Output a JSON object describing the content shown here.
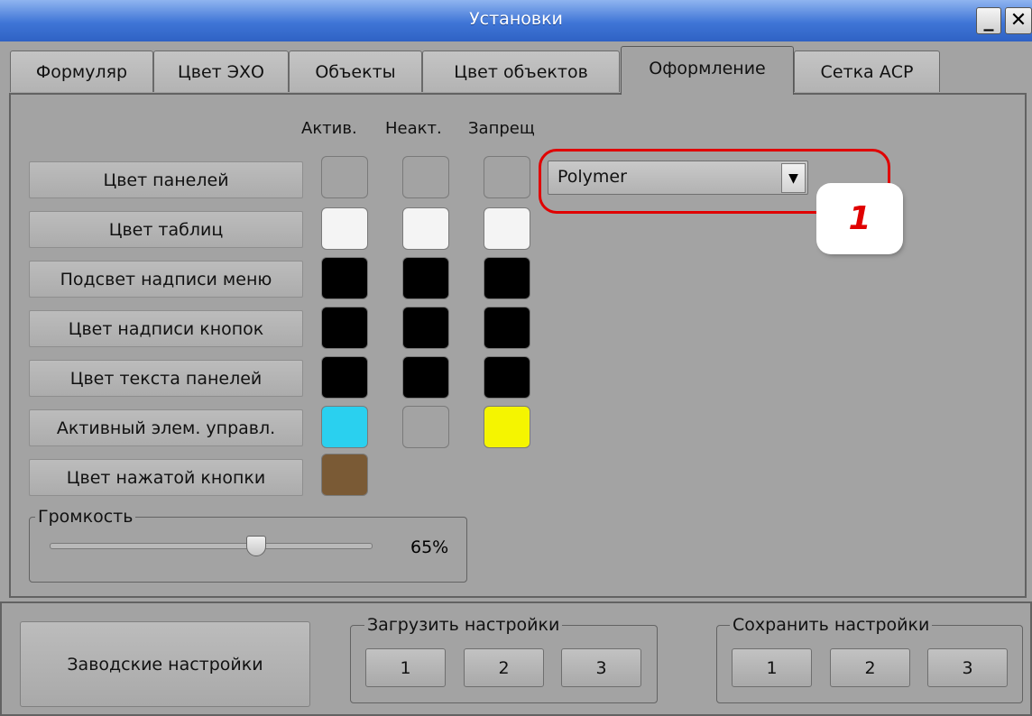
{
  "window": {
    "title": "Установки"
  },
  "tabs": [
    "Формуляр",
    "Цвет ЭХО",
    "Объекты",
    "Цвет объектов",
    "Оформление",
    "Сетка АСР"
  ],
  "active_tab": "Оформление",
  "columns": [
    "Актив.",
    "Неакт.",
    "Запрещ"
  ],
  "rows": [
    {
      "label": "Цвет панелей",
      "colors": [
        "#a3a3a3",
        "#a3a3a3",
        "#a3a3a3"
      ]
    },
    {
      "label": "Цвет таблиц",
      "colors": [
        "#f4f4f4",
        "#f4f4f4",
        "#f4f4f4"
      ]
    },
    {
      "label": "Подсвет надписи меню",
      "colors": [
        "#000000",
        "#000000",
        "#000000"
      ]
    },
    {
      "label": "Цвет надписи кнопок",
      "colors": [
        "#000000",
        "#000000",
        "#000000"
      ]
    },
    {
      "label": "Цвет текста панелей",
      "colors": [
        "#000000",
        "#000000",
        "#000000"
      ]
    },
    {
      "label": "Активный элем. управл.",
      "colors": [
        "#2ad0ef",
        "#a3a3a3",
        "#f5f500"
      ]
    },
    {
      "label": "Цвет нажатой кнопки",
      "colors": [
        "#7a5a35"
      ]
    }
  ],
  "theme_select": {
    "value": "Polymer"
  },
  "callout": {
    "number": "1"
  },
  "volume": {
    "label": "Громкость",
    "value_text": "65%",
    "value": 0.65
  },
  "bottom": {
    "factory_button": "Заводские настройки",
    "load_group": {
      "label": "Загрузить настройки",
      "buttons": [
        "1",
        "2",
        "3"
      ]
    },
    "save_group": {
      "label": "Сохранить настройки",
      "buttons": [
        "1",
        "2",
        "3"
      ]
    }
  }
}
